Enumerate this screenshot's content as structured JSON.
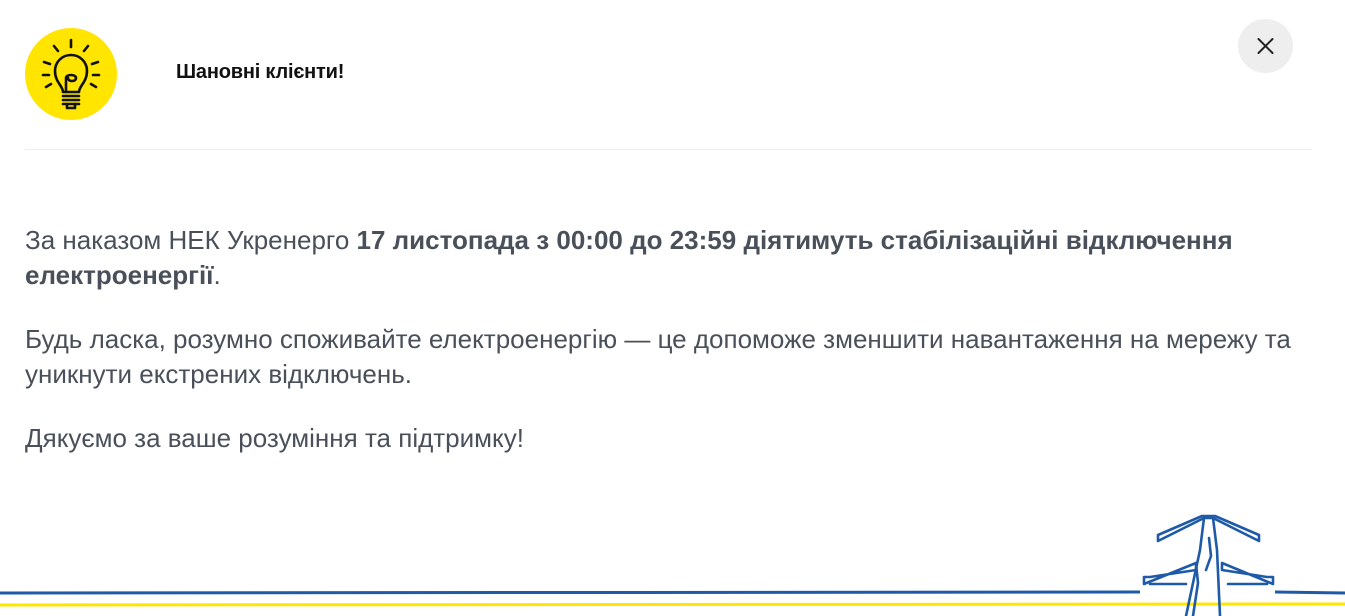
{
  "header": {
    "icon": "lightbulb-icon",
    "title": "Шановні клієнти!",
    "close": "close-icon"
  },
  "message": {
    "p1_prefix": "За наказом НЕК Укренерго ",
    "p1_bold": "17 листопада з 00:00 до 23:59 діятимуть стабілізаційні відключення електроенергії",
    "p1_suffix": ".",
    "p2": "Будь ласка, розумно споживайте електроенергію — це допоможе зменшити навантаження на мережу та уникнути екстрених відключень.",
    "p3": "Дякуємо за ваше розуміння та підтримку!"
  },
  "decoration": {
    "icon": "power-pylon-icon",
    "colors": {
      "blue": "#1E5AA8",
      "yellow": "#FFE500"
    }
  },
  "colors": {
    "accent_yellow": "#FFE500",
    "text": "#4A505A",
    "title": "#111111",
    "close_bg": "#EEEEEE"
  }
}
